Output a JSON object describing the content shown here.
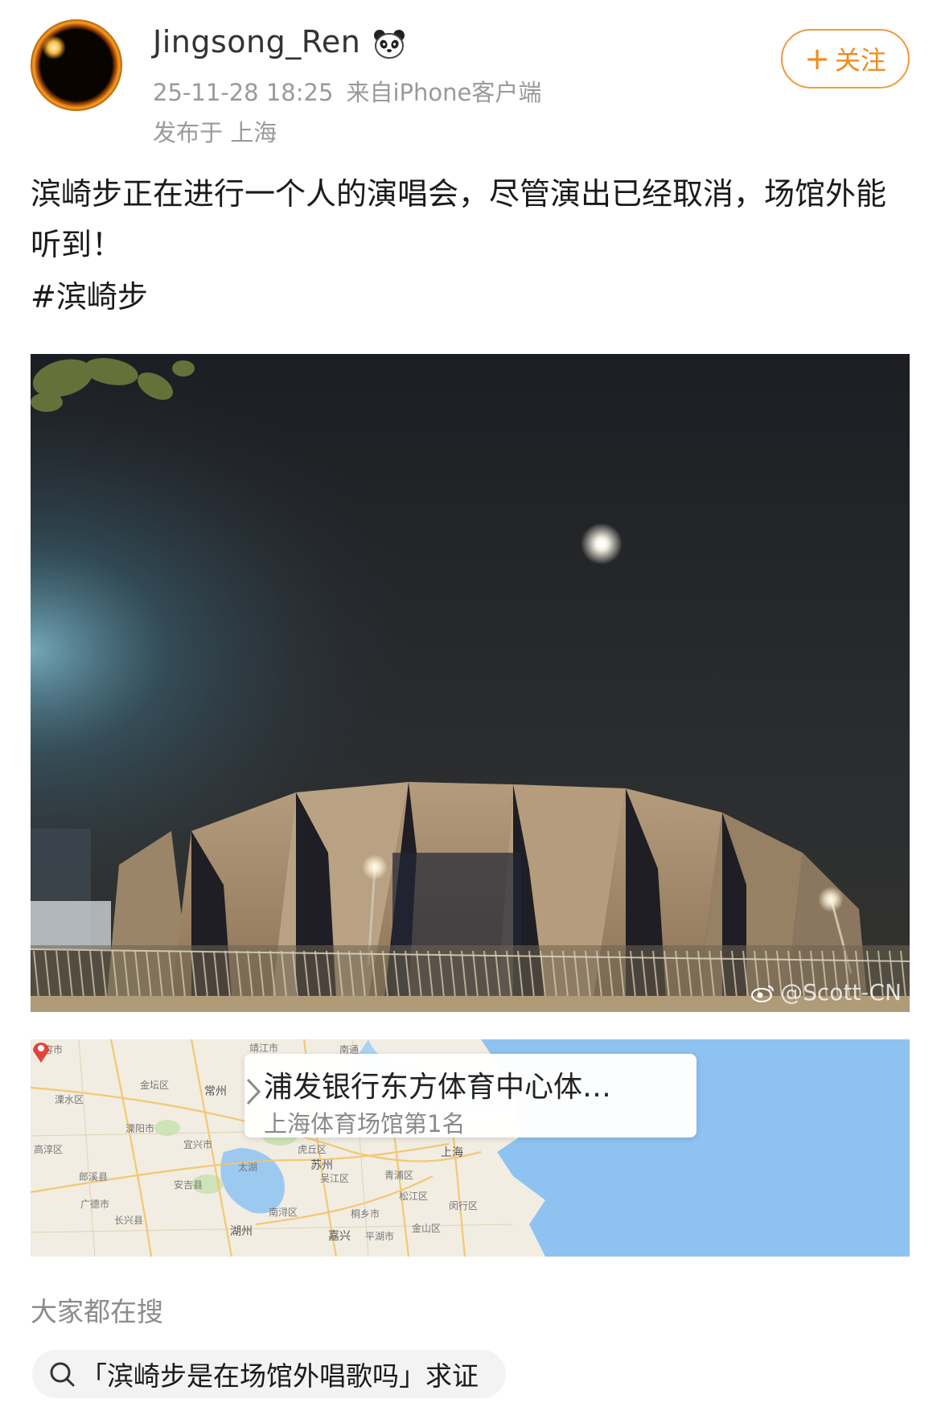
{
  "post": {
    "author": "Jingsong_Ren",
    "timestamp": "25-11-28 18:25",
    "source": "来自iPhone客户端",
    "location": "发布于 上海",
    "follow_label": "关注",
    "text": "滨崎步正在进行一个人的演唱会，尽管演出已经取消，场馆外能听到！",
    "hashtag": "#滨崎步",
    "image_watermark": "@Scott-CN",
    "icons": [
      "panda-badge-icon",
      "plus-icon",
      "weibo-logo-icon",
      "chevron-right-icon",
      "search-icon",
      "location-pin-icon"
    ]
  },
  "map": {
    "place_name": "浦发银行东方体育中心体…",
    "place_rank": "上海体育场馆第1名",
    "labels": [
      "句容市",
      "金坛区",
      "常州",
      "溧水区",
      "溧阳市",
      "宜兴市",
      "高淳区",
      "郎溪县",
      "广德市",
      "长兴县",
      "湖州",
      "太湖",
      "苏州",
      "吴江区",
      "虎丘区",
      "青浦区",
      "上海",
      "松江区",
      "嘉兴",
      "平湖市",
      "金山区",
      "南浔区",
      "桐乡市",
      "闵行区",
      "安吉县",
      "靖江市",
      "南通"
    ],
    "colors": {
      "land": "#f1ede2",
      "water": "#8ec2f0",
      "green": "#cfe3b8",
      "road": "#f3c46a"
    }
  },
  "search": {
    "section_title": "大家都在搜",
    "chip_text": "「滨崎步是在场馆外唱歌吗」求证"
  },
  "colors": {
    "accent_orange": "#f08a1e",
    "text_primary": "#1a1a1a",
    "text_secondary": "#9a9a9a"
  }
}
